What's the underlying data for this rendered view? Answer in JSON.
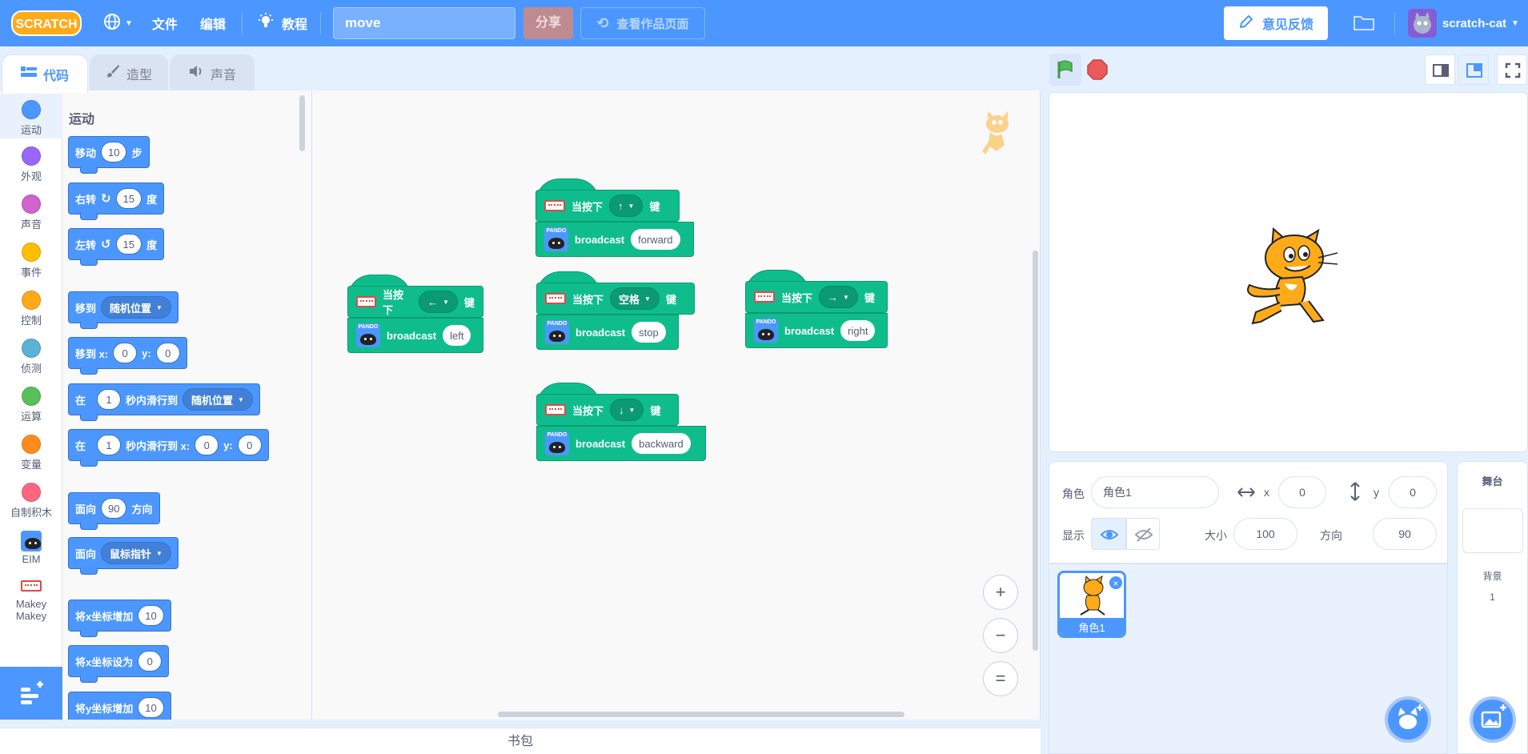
{
  "menubar": {
    "logo": "SCRATCH",
    "file": "文件",
    "edit": "编辑",
    "tutorials": "教程",
    "project_title": "move",
    "share": "分享",
    "see_project_page": "查看作品页面",
    "feedback": "意见反馈",
    "username": "scratch-cat"
  },
  "tabs": {
    "code": "代码",
    "costumes": "造型",
    "sounds": "声音"
  },
  "categories": [
    {
      "label": "运动",
      "color": "#4c97ff"
    },
    {
      "label": "外观",
      "color": "#9966ff"
    },
    {
      "label": "声音",
      "color": "#cf63cf"
    },
    {
      "label": "事件",
      "color": "#ffbf00"
    },
    {
      "label": "控制",
      "color": "#ffab19"
    },
    {
      "label": "侦测",
      "color": "#5cb1d6"
    },
    {
      "label": "运算",
      "color": "#59c059"
    },
    {
      "label": "变量",
      "color": "#ff8c1a"
    },
    {
      "label": "自制积木",
      "color": "#ff6680"
    },
    {
      "label": "EIM"
    },
    {
      "label": "Makey Makey"
    }
  ],
  "palette": {
    "heading": "运动",
    "move": {
      "a": "移动",
      "n": "10",
      "b": "步"
    },
    "turn_right": {
      "a": "右转",
      "n": "15",
      "b": "度"
    },
    "turn_left": {
      "a": "左转",
      "n": "15",
      "b": "度"
    },
    "goto": {
      "a": "移到",
      "d": "随机位置"
    },
    "goto_xy": {
      "a": "移到 x:",
      "x": "0",
      "yl": "y:",
      "y": "0"
    },
    "glide": {
      "a": "在",
      "n": "1",
      "b": "秒内滑行到",
      "d": "随机位置"
    },
    "glide_xy": {
      "a": "在",
      "n": "1",
      "b": "秒内滑行到 x:",
      "x": "0",
      "yl": "y:",
      "y": "0"
    },
    "point_dir": {
      "a": "面向",
      "n": "90",
      "b": "方向"
    },
    "point_towards": {
      "a": "面向",
      "d": "鼠标指针"
    },
    "change_x": {
      "a": "将x坐标增加",
      "n": "10"
    },
    "set_x": {
      "a": "将x坐标设为",
      "n": "0"
    },
    "change_y": {
      "a": "将y坐标增加",
      "n": "10"
    }
  },
  "scripts": {
    "when": "当按下",
    "key": "键",
    "broadcast": "broadcast",
    "eim_label": "PANDO",
    "left": {
      "key": "←",
      "msg": "left"
    },
    "up": {
      "key": "↑",
      "msg": "forward"
    },
    "space": {
      "key": "空格",
      "msg": "stop"
    },
    "right": {
      "key": "→",
      "msg": "right"
    },
    "down": {
      "key": "↓",
      "msg": "backward"
    }
  },
  "zoom": {
    "in": "+",
    "out": "−",
    "reset": "="
  },
  "backpack": "书包",
  "sprite_info": {
    "sprite_label": "角色",
    "sprite_name": "角色1",
    "x_label": "x",
    "x": "0",
    "y_label": "y",
    "y": "0",
    "show_label": "显示",
    "size_label": "大小",
    "size": "100",
    "direction_label": "方向",
    "direction": "90"
  },
  "sprite_list": [
    {
      "name": "角色1"
    }
  ],
  "stage_panel": {
    "title": "舞台",
    "backdrops_label": "背景",
    "backdrops_count": "1"
  }
}
